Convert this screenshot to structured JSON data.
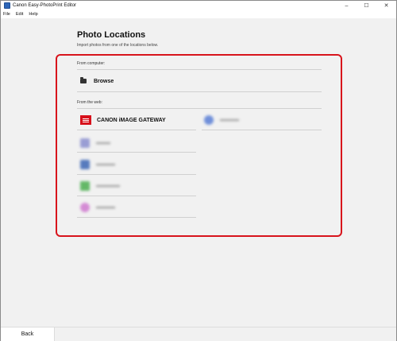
{
  "window": {
    "title": "Canon Easy-PhotoPrint Editor",
    "controls": {
      "minimize": "–",
      "maximize": "☐",
      "close": "✕"
    }
  },
  "menu": {
    "items": [
      "File",
      "Edit",
      "Help"
    ]
  },
  "page": {
    "title": "Photo Locations",
    "subtitle": "Import photos from one of the locations below."
  },
  "sections": {
    "computer": {
      "label": "From computer:",
      "browse": {
        "label": "Browse",
        "icon": "folder-icon"
      }
    },
    "web": {
      "label": "From the web:",
      "services": [
        {
          "label": "CANON iMAGE GATEWAY",
          "icon": "canon-image-gateway-icon",
          "color": "#d7101b"
        }
      ],
      "blurred_services": [
        {
          "icon": "service-icon",
          "color": "#5a7fd6"
        },
        {
          "icon": "service-icon",
          "color": "#8a8fcf"
        },
        {
          "icon": "service-icon",
          "color": "#3d67b5"
        },
        {
          "icon": "service-icon",
          "color": "#4caf50"
        },
        {
          "icon": "service-icon",
          "color": "#d07ad0"
        }
      ]
    }
  },
  "footer": {
    "back_label": "Back"
  },
  "colors": {
    "highlight": "#d8141c",
    "background": "#f1f1f1"
  }
}
